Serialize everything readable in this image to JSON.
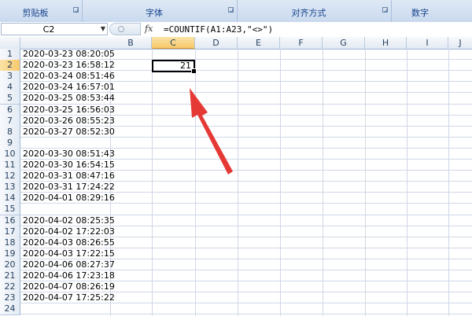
{
  "ribbon": {
    "groups": [
      {
        "label": "剪贴板"
      },
      {
        "label": "字体"
      },
      {
        "label": "对齐方式"
      },
      {
        "label": "数字"
      }
    ]
  },
  "formula_bar": {
    "name_box": "C2",
    "fx_label": "fx",
    "formula": "=COUNTIF(A1:A23,\"<>\")"
  },
  "columns": [
    "B",
    "C",
    "D",
    "E",
    "F",
    "G",
    "H",
    "I",
    "J"
  ],
  "selected_column": "C",
  "rows": [
    {
      "num": "1",
      "a": "2020-03-23 08:20:05"
    },
    {
      "num": "2",
      "a": "2020-03-23 16:58:12"
    },
    {
      "num": "3",
      "a": "2020-03-24 08:51:46"
    },
    {
      "num": "4",
      "a": "2020-03-24 16:57:01"
    },
    {
      "num": "5",
      "a": "2020-03-25 08:53:44"
    },
    {
      "num": "6",
      "a": "2020-03-25 16:56:03"
    },
    {
      "num": "7",
      "a": "2020-03-26 08:55:23"
    },
    {
      "num": "8",
      "a": "2020-03-27 08:52:30"
    },
    {
      "num": "9",
      "a": ""
    },
    {
      "num": "10",
      "a": "2020-03-30 08:51:43"
    },
    {
      "num": "11",
      "a": "2020-03-30 16:54:15"
    },
    {
      "num": "12",
      "a": "2020-03-31 08:47:16"
    },
    {
      "num": "13",
      "a": "2020-03-31 17:24:22"
    },
    {
      "num": "14",
      "a": "2020-04-01 08:29:16"
    },
    {
      "num": "15",
      "a": ""
    },
    {
      "num": "16",
      "a": "2020-04-02 08:25:35"
    },
    {
      "num": "17",
      "a": "2020-04-02 17:22:03"
    },
    {
      "num": "18",
      "a": "2020-04-03 08:26:55"
    },
    {
      "num": "19",
      "a": "2020-04-03 17:22:15"
    },
    {
      "num": "20",
      "a": "2020-04-06 08:27:37"
    },
    {
      "num": "21",
      "a": "2020-04-06 17:23:18"
    },
    {
      "num": "22",
      "a": "2020-04-07 08:26:19"
    },
    {
      "num": "23",
      "a": "2020-04-07 17:25:22"
    },
    {
      "num": "24",
      "a": ""
    }
  ],
  "active_cell": {
    "address": "C2",
    "value": "21"
  },
  "annotation": {
    "color": "#e53935"
  }
}
